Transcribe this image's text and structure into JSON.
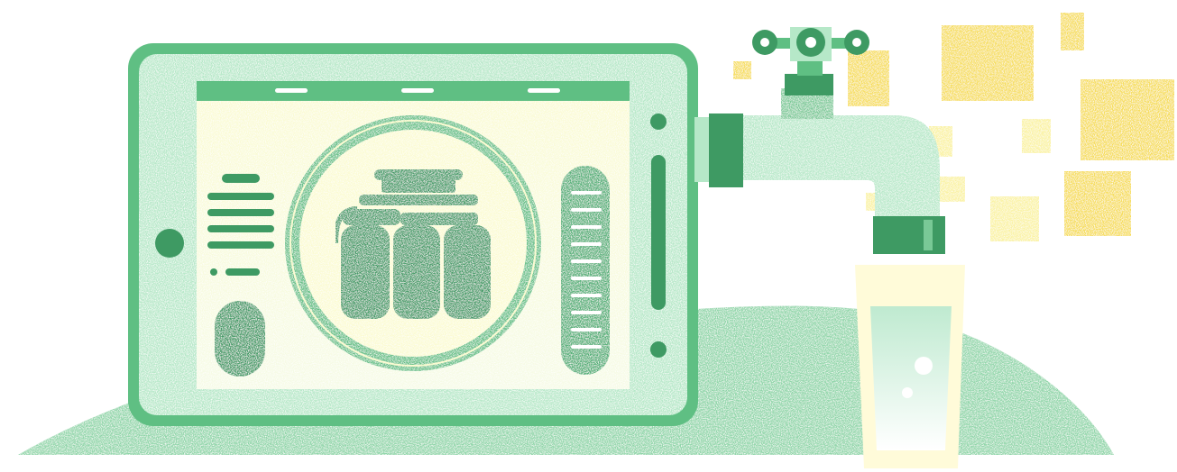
{
  "colors": {
    "background": "#ffffff",
    "hill": "#8fd6a9",
    "frame": "#5fbf83",
    "frame_light": "#b6e8c8",
    "dark_green": "#3e9a63",
    "mid_green": "#79c996",
    "pale_green": "#c9efd6",
    "screen_yellow": "#fbfbd2",
    "yellow": "#f6dd55",
    "pale_yellow": "#faf2a0",
    "glass": "#fffbd9",
    "water": "#d2f0dd"
  },
  "icons": {
    "tablet": "tablet-device-icon",
    "filter": "water-filter-icon",
    "faucet": "faucet-icon",
    "glass": "water-glass-icon"
  }
}
